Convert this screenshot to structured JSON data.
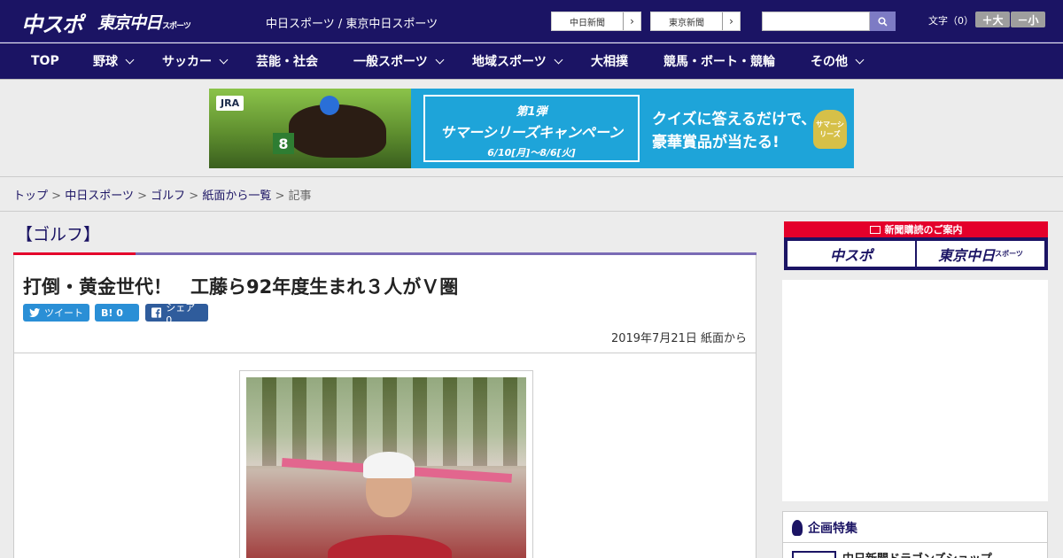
{
  "header": {
    "logo_chuspo": "中スポ",
    "logo_tokyo": "東京中日",
    "logo_tokyo_small": "スポーツ",
    "site_links": "中日スポーツ / 東京中日スポーツ",
    "paper_link_1": "中日新聞",
    "paper_link_2": "東京新聞",
    "paper_arrow": "›",
    "search_placeholder": "",
    "search_icon": "magnifier",
    "font_size_label": "文字（0）",
    "font_larger": "＋大",
    "font_smaller": "－小"
  },
  "nav": {
    "items": [
      {
        "label": "TOP",
        "dropdown": false
      },
      {
        "label": "野球",
        "dropdown": true
      },
      {
        "label": "サッカー",
        "dropdown": true
      },
      {
        "label": "芸能・社会",
        "dropdown": false
      },
      {
        "label": "一般スポーツ",
        "dropdown": true
      },
      {
        "label": "地域スポーツ",
        "dropdown": true
      },
      {
        "label": "大相撲",
        "dropdown": false
      },
      {
        "label": "競馬・ボート・競輪",
        "dropdown": false
      },
      {
        "label": "その他",
        "dropdown": true
      }
    ]
  },
  "banner": {
    "jra": "JRA",
    "number": "8",
    "campaign_line1": "第1弾",
    "campaign_line2": "サマーシリーズキャンペーン",
    "campaign_line3": "6/10[月]～8/6[火]",
    "quiz_line1": "クイズに答えるだけで、",
    "quiz_line2": "豪華賞品が当たる!",
    "trophy": "サマーシリーズ"
  },
  "breadcrumb": {
    "items": [
      "トップ",
      "中日スポーツ",
      "ゴルフ",
      "紙面から一覧"
    ],
    "current": "記事",
    "separator": ">"
  },
  "article": {
    "category": "【ゴルフ】",
    "headline": "打倒・黄金世代！　工藤ら92年度生まれ３人がＶ圏",
    "share_twitter": "ツイート",
    "share_hatena": "B! 0",
    "share_facebook": "シェア 0",
    "date": "2019年7月21日 紙面から"
  },
  "sidebar": {
    "subscribe_head": "新聞購読のご案内",
    "subscribe_chuspo": "中スポ",
    "subscribe_tokyo": "東京中日",
    "subscribe_tokyo_small": "スポーツ",
    "feature_title": "企画特集",
    "feature_item": "中日新聞ドラゴンズショップ"
  },
  "colors": {
    "brand_navy": "#1b1464",
    "accent_red": "#e4002b",
    "accent_purple": "#7a6bb5",
    "twitter_blue": "#2a8fd6",
    "facebook_blue": "#2f5c9c"
  }
}
